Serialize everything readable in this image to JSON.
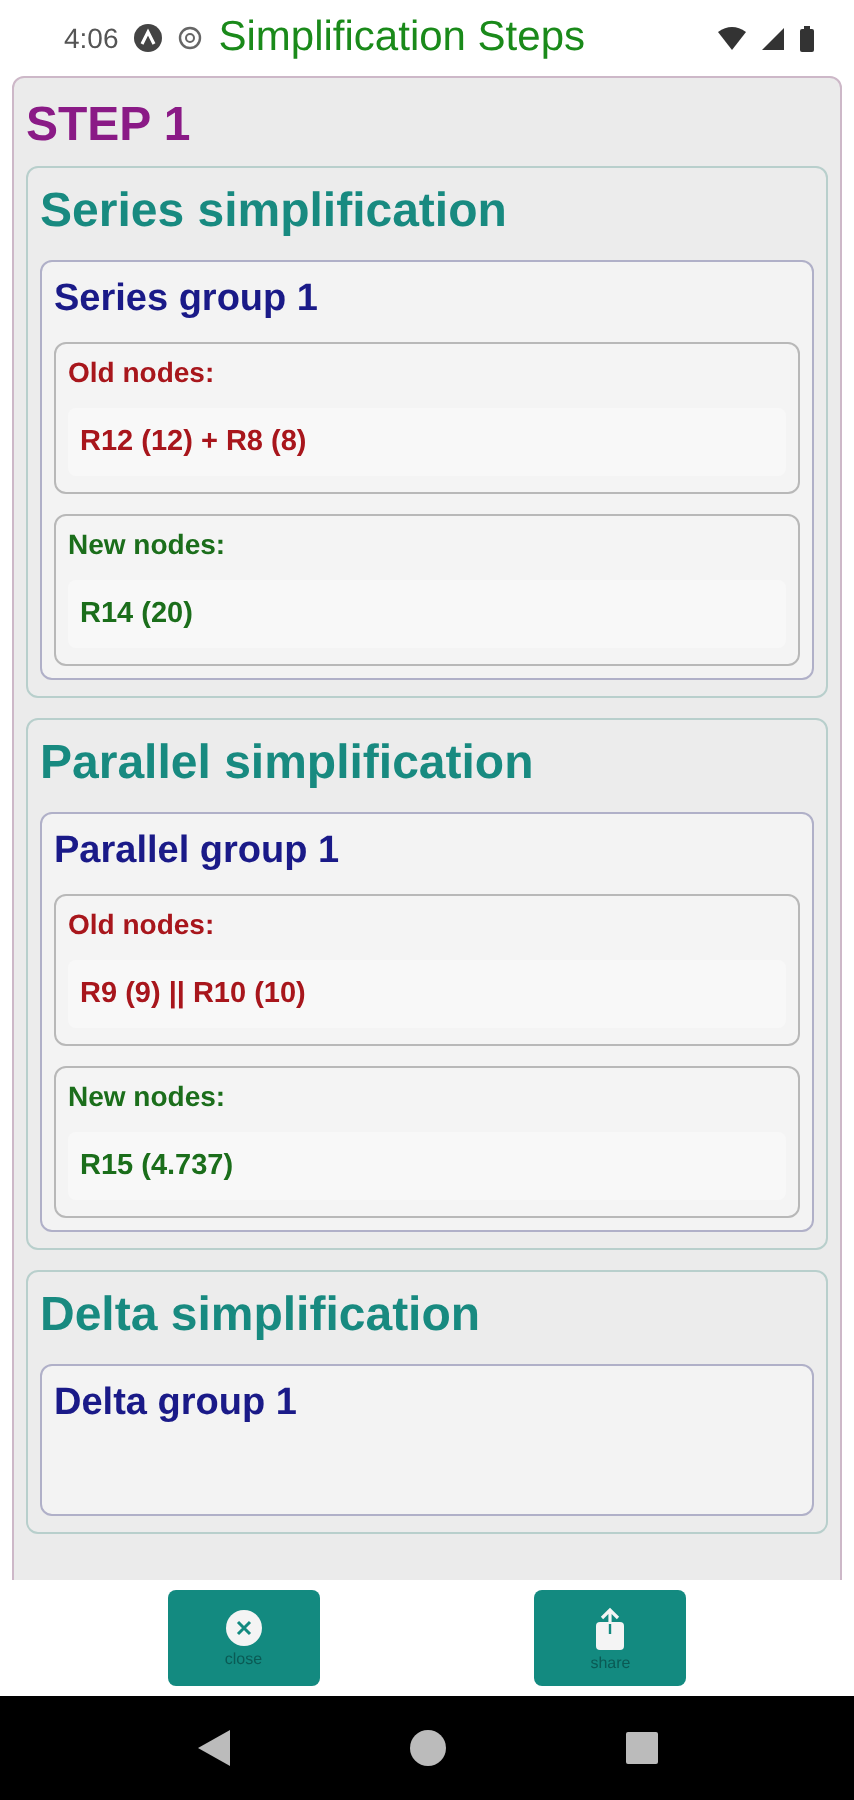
{
  "status_bar": {
    "time": "4:06",
    "title": "Simplification Steps"
  },
  "step": {
    "title": "STEP 1",
    "sections": [
      {
        "title": "Series simplification",
        "groups": [
          {
            "title": "Series group 1",
            "entries": [
              {
                "kind": "old",
                "label": "Old nodes:",
                "value": "R12 (12) + R8 (8)"
              },
              {
                "kind": "new",
                "label": "New nodes:",
                "value": "R14 (20)"
              }
            ]
          }
        ]
      },
      {
        "title": "Parallel simplification",
        "groups": [
          {
            "title": "Parallel group 1",
            "entries": [
              {
                "kind": "old",
                "label": "Old nodes:",
                "value": "R9 (9) || R10 (10)"
              },
              {
                "kind": "new",
                "label": "New nodes:",
                "value": "R15 (4.737)"
              }
            ]
          }
        ]
      },
      {
        "title": "Delta simplification",
        "groups": [
          {
            "title": "Delta group 1"
          }
        ]
      }
    ]
  },
  "buttons": [
    {
      "kind": "close",
      "label": "close"
    },
    {
      "kind": "share",
      "label": "share"
    }
  ]
}
